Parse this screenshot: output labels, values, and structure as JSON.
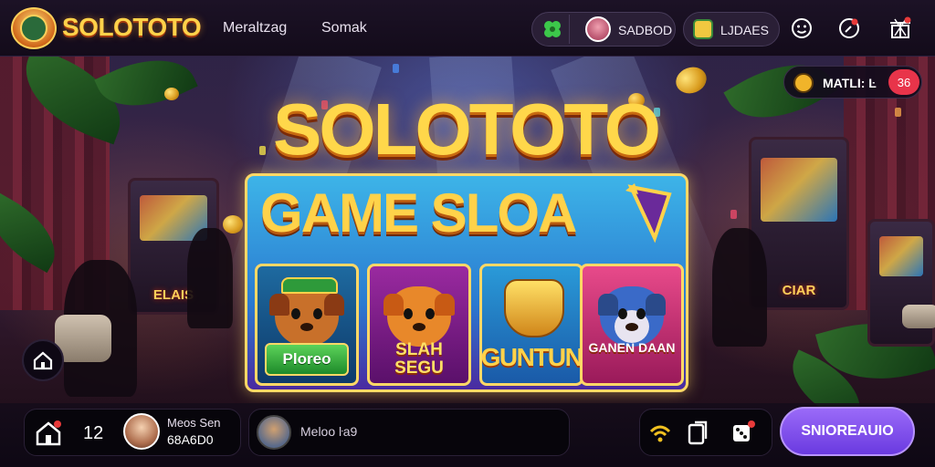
{
  "brand": {
    "name": "SOLOTOTO"
  },
  "nav": {
    "items": [
      "Meraltzag",
      "Somak"
    ]
  },
  "header": {
    "profile_name": "SADBOD",
    "wallet_label": "LJDAES"
  },
  "promo": {
    "label": "MATLI: Ŀ",
    "count": "36"
  },
  "hero": {
    "title": "SOLOTOTO",
    "panel_title": "GAME SLOA",
    "cards": [
      {
        "label": "Ploreo"
      },
      {
        "label": "SLAH SEGU"
      },
      {
        "label": "MENGUNTUNGAN"
      },
      {
        "label": "GANEN DAAN"
      }
    ]
  },
  "bottom": {
    "count": "12",
    "user_name": "Meos Sen",
    "user_id": "68A6D0",
    "chat_text": "Meloo ŀa9",
    "cta": "SNIOREAUIO"
  },
  "colors": {
    "accent_gold": "#ffd24a",
    "cta_purple": "#7a4aee",
    "card_green": "#2ea63a"
  },
  "icons": {
    "topbar": [
      "clover-icon",
      "smile-icon",
      "compass-icon",
      "gift-icon"
    ],
    "bottom": [
      "home-icon",
      "wifi-icon",
      "card-icon",
      "dice-icon"
    ]
  }
}
